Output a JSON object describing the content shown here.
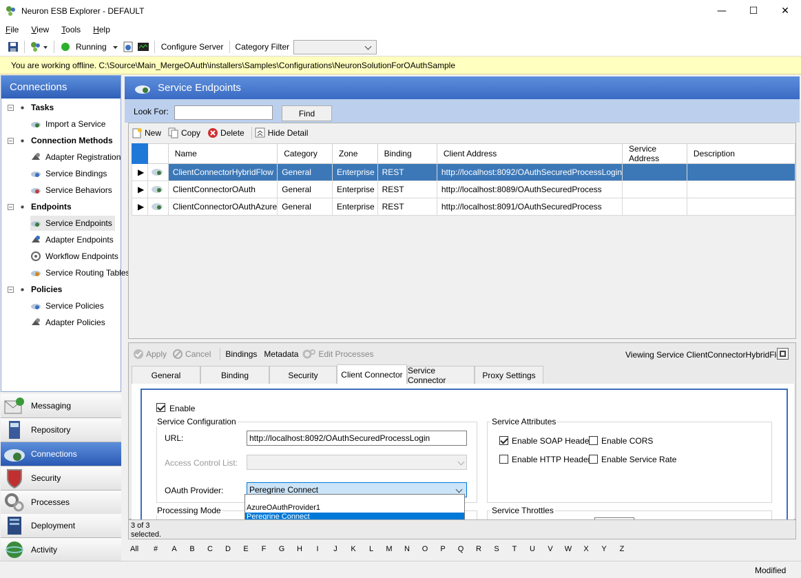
{
  "window": {
    "title": "Neuron ESB Explorer - DEFAULT"
  },
  "menu": [
    {
      "pre": "",
      "u": "F",
      "post": "ile"
    },
    {
      "pre": "",
      "u": "V",
      "post": "iew"
    },
    {
      "pre": "",
      "u": "T",
      "post": "ools"
    },
    {
      "pre": "",
      "u": "H",
      "post": "elp"
    }
  ],
  "toolbar": {
    "running_label": "Running",
    "configure_server": "Configure Server",
    "category_filter": "Category Filter",
    "category_value": ""
  },
  "info_bar": "You are working offline. C:\\Source\\Main_MergeOAuth\\installers\\Samples\\Configurations\\NeuronSolutionForOAuthSample",
  "left_panel": {
    "title": "Connections",
    "tree": [
      {
        "label": "Tasks",
        "items": [
          "Import a Service"
        ]
      },
      {
        "label": "Connection Methods",
        "items": [
          "Adapter Registration",
          "Service Bindings",
          "Service Behaviors"
        ]
      },
      {
        "label": "Endpoints",
        "items": [
          "Service Endpoints",
          "Adapter Endpoints",
          "Workflow Endpoints",
          "Service Routing Tables"
        ]
      },
      {
        "label": "Policies",
        "items": [
          "Service Policies",
          "Adapter Policies"
        ]
      }
    ]
  },
  "nav": [
    "Messaging",
    "Repository",
    "Connections",
    "Security",
    "Processes",
    "Deployment",
    "Activity"
  ],
  "main": {
    "title": "Service Endpoints",
    "look_for_label": "Look For:",
    "look_for_value": "",
    "find_button": "Find",
    "grid_tools": {
      "new": "New",
      "copy": "Copy",
      "delete": "Delete",
      "hide_detail": "Hide Detail"
    },
    "columns": [
      "Name",
      "Category",
      "Zone",
      "Binding",
      "Client Address",
      "Service Address",
      "Description"
    ],
    "rows": [
      [
        "ClientConnectorHybridFlow",
        "General",
        "Enterprise",
        "REST",
        "http://localhost:8092/OAuthSecuredProcessLogin",
        "",
        ""
      ],
      [
        "ClientConnectorOAuth",
        "General",
        "Enterprise",
        "REST",
        "http://localhost:8089/OAuthSecuredProcess",
        "",
        ""
      ],
      [
        "ClientConnectorOAuthAzure",
        "General",
        "Enterprise",
        "REST",
        "http://localhost:8091/OAuthSecuredProcess",
        "",
        ""
      ]
    ]
  },
  "detail": {
    "apply": "Apply",
    "cancel": "Cancel",
    "bindings": "Bindings",
    "metadata": "Metadata",
    "edit_processes": "Edit Processes",
    "viewing": "Viewing Service ClientConnectorHybridFlow",
    "tabs": [
      "General",
      "Binding",
      "Security",
      "Client Connector",
      "Service Connector",
      "Proxy Settings"
    ],
    "enable_label": "Enable",
    "service_configuration": "Service Configuration",
    "url_label": "URL:",
    "url_value": "http://localhost:8092/OAuthSecuredProcessLogin",
    "acl_label": "Access Control List:",
    "oauth_label": "OAuth Provider:",
    "oauth_value": "Peregrine Connect",
    "oauth_options": [
      "AzureOAuthProvider1",
      "Peregrine Connect"
    ],
    "processing_mode": "Processing Mode",
    "service_attributes": "Service Attributes",
    "enable_soap": "Enable SOAP Headers",
    "enable_cors": "Enable CORS",
    "enable_http": "Enable HTTP Headers",
    "enable_rate": "Enable Service Rate",
    "service_throttles": "Service Throttles"
  },
  "status": {
    "count": "3 of 3",
    "selected": "selected.",
    "modified": "Modified"
  },
  "alphabet": [
    "All",
    "#",
    "A",
    "B",
    "C",
    "D",
    "E",
    "F",
    "G",
    "H",
    "I",
    "J",
    "K",
    "L",
    "M",
    "N",
    "O",
    "P",
    "Q",
    "R",
    "S",
    "T",
    "U",
    "V",
    "W",
    "X",
    "Y",
    "Z"
  ]
}
